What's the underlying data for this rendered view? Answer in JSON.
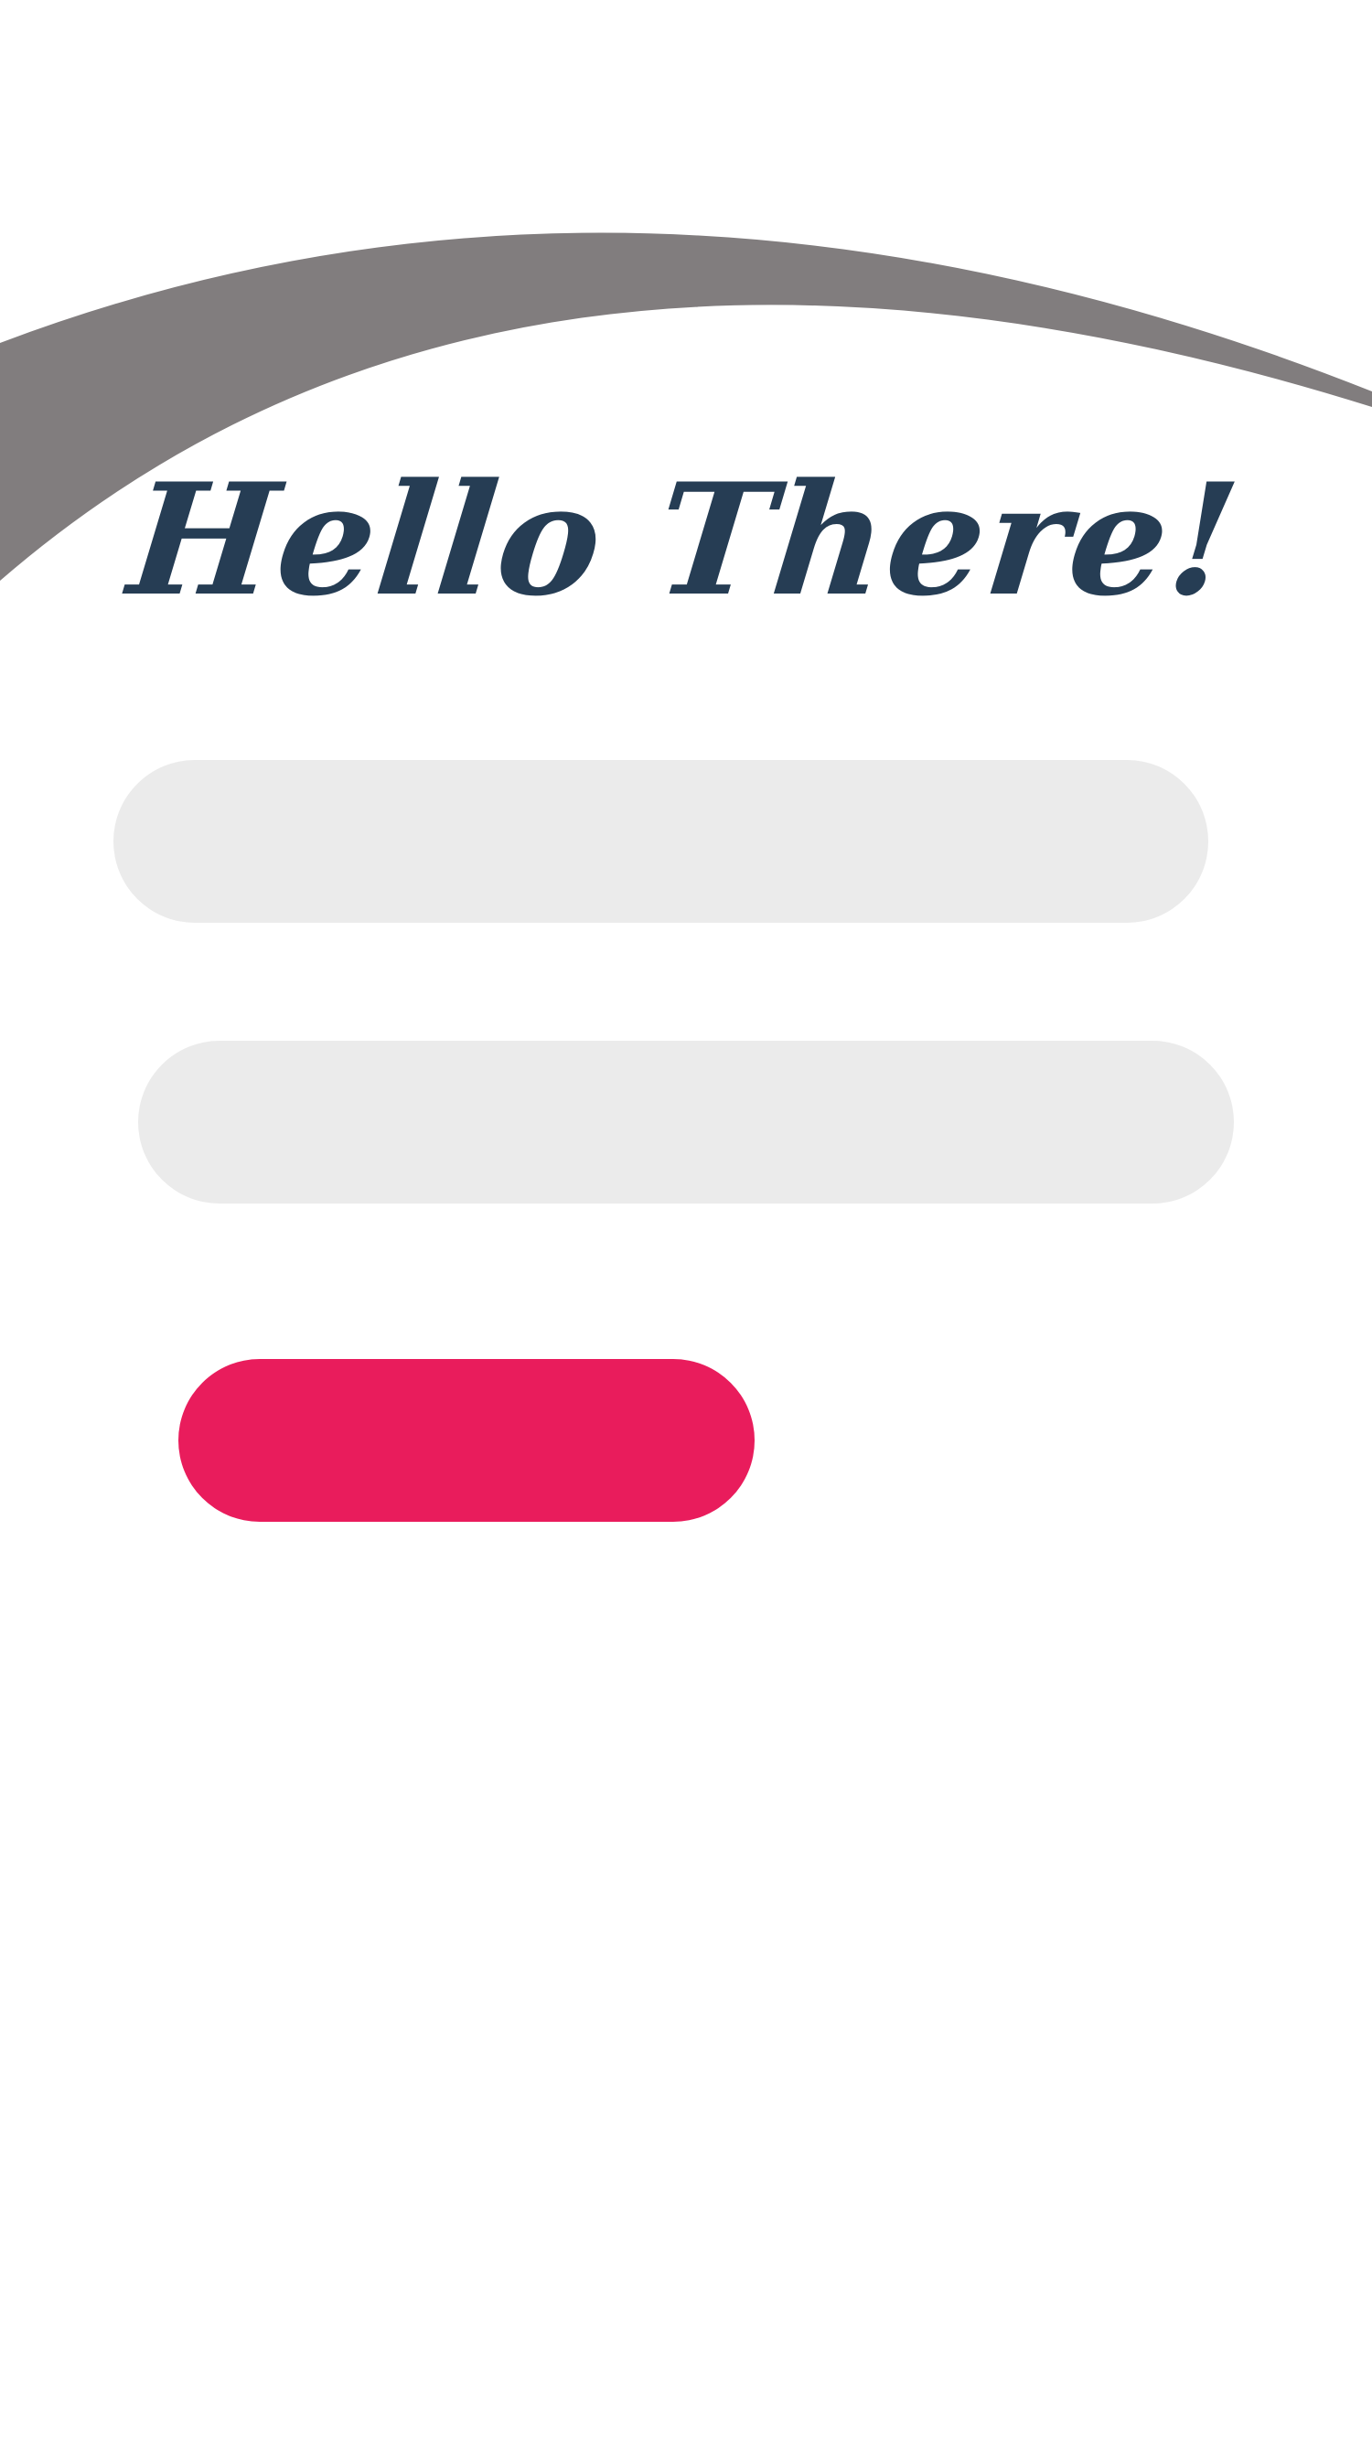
{
  "header": {
    "arc_color": "#817d7e",
    "background_color": "#ffffff"
  },
  "greeting": {
    "text": "Hello There!",
    "color": "#263d54"
  },
  "form": {
    "field_1": {
      "value": "",
      "placeholder": "",
      "background": "#ebebeb"
    },
    "field_2": {
      "value": "",
      "placeholder": "",
      "background": "#ebebeb"
    },
    "submit": {
      "label": "",
      "background": "#e91c5c"
    }
  }
}
